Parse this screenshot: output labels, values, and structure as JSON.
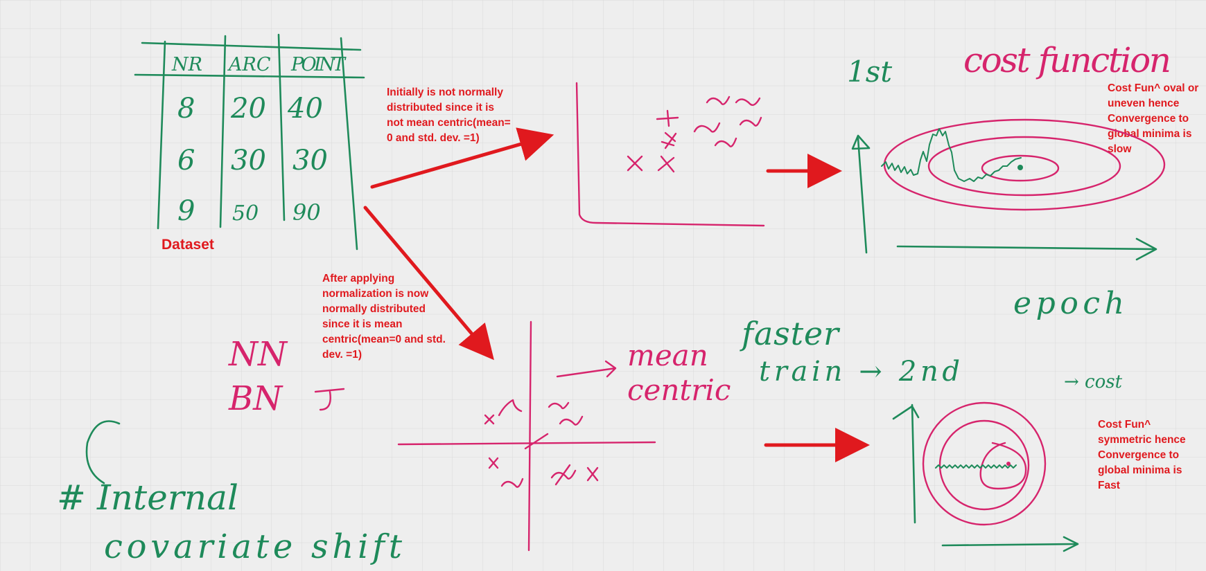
{
  "table": {
    "headers": [
      "NR",
      "ARC",
      "POINT"
    ],
    "rows": [
      [
        "8",
        "20",
        "40"
      ],
      [
        "6",
        "30",
        "30"
      ],
      [
        "9",
        "50",
        "90"
      ]
    ],
    "caption": "Dataset"
  },
  "notes": {
    "initial": [
      "Initially is not normally",
      "distributed  since it is",
      "not mean centric(mean=",
      "0 and std. dev. =1)"
    ],
    "after": [
      "After applying",
      "normalization is now",
      "normally distributed",
      "since it is mean",
      "centric(mean=0 and std.",
      "dev. =1)"
    ],
    "cost_oval": [
      "Cost Fun^ oval or",
      "uneven hence",
      "Convergence to",
      "global minima is",
      "slow"
    ],
    "cost_symmetric": [
      "Cost Fun^",
      "symmetric hence",
      "Convergence to",
      "global minima is",
      "Fast"
    ]
  },
  "handwriting": {
    "first": "1st",
    "cost_function": "cost function",
    "epoch": "epoch",
    "faster": "faster",
    "train_second": "train → 2nd",
    "cost_short": "→ cost",
    "mean_centric": [
      "mean",
      "centric"
    ],
    "nn": "NN",
    "bn": "BN",
    "internal": "# Internal",
    "covariate": "covariate shift"
  },
  "colors": {
    "board": "#eeeeee",
    "grid": "#dcdcdc",
    "ink_green": "#1e8a5a",
    "ink_pink": "#d6246c",
    "ink_red": "#e0191e"
  }
}
